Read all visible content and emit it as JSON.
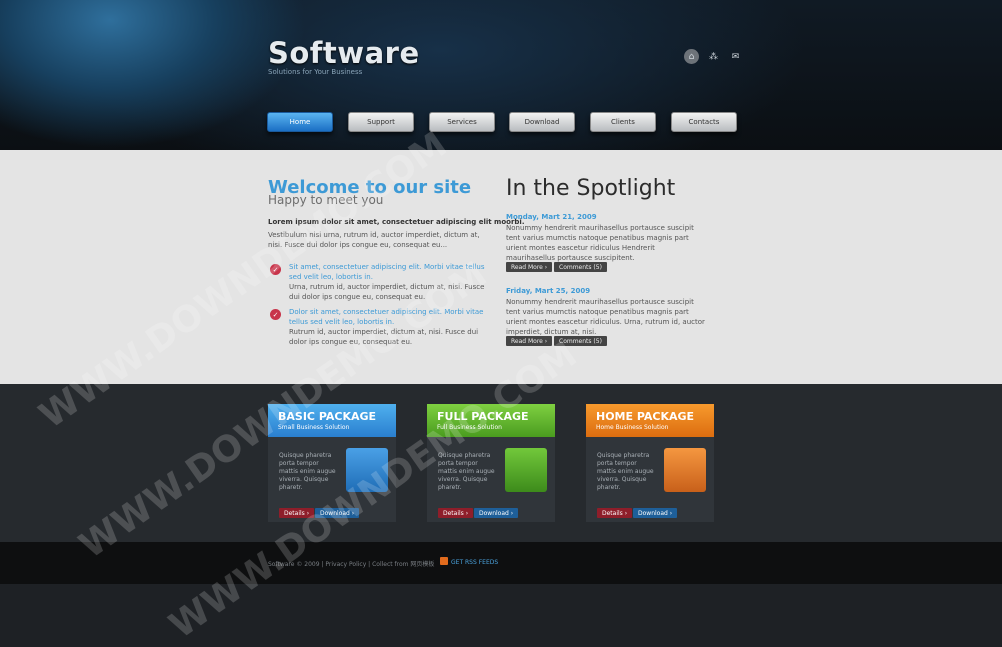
{
  "header": {
    "logo": "Software",
    "tagline": "Solutions for Your Business",
    "icons": [
      "home-icon",
      "sitemap-icon",
      "mail-icon"
    ]
  },
  "nav": {
    "items": [
      "Home",
      "Support",
      "Services",
      "Download",
      "Clients",
      "Contacts"
    ]
  },
  "welcome": {
    "title": "Welcome to our site",
    "subtitle": "Happy to meet you",
    "lead": "Lorem ipsum dolor sit amet, consectetuer adipiscing elit moorbi.",
    "para": "Vestibulum nisi urna, rutrum id, auctor imperdiet, dictum at, nisi. Fusce dui dolor ips congue eu, consequat eu...",
    "items": [
      {
        "highlight": "Sit amet, consectetuer adipiscing elit. Morbi vitae tellus sed velit leo, lobortis in.",
        "text": "Urna, rutrum id, auctor imperdiet, dictum at, nisi. Fusce dui dolor ips congue eu, consequat eu."
      },
      {
        "highlight": "Dolor sit amet, consectetuer adipiscing elit. Morbi vitae tellus sed velit leo, lobortis in.",
        "text": "Rutrum id, auctor imperdiet, dictum at, nisi. Fusce dui dolor ips congue eu, consequat eu."
      }
    ]
  },
  "spotlight": {
    "title": "In the Spotlight",
    "posts": [
      {
        "date": "Monday, Mart 21, 2009",
        "text": "Nonummy hendrerit maurihasellus portausce suscipit tent varius mumctis natoque penatibus magnis part urient montes eascetur ridiculus Hendrerit maurihasellus portausce suscipitent.",
        "read_more": "Read More ›",
        "comments": "Comments (5)"
      },
      {
        "date": "Friday, Mart 25, 2009",
        "text": "Nonummy hendrerit maurihasellus portausce suscipit tent varius mumctis natoque penatibus magnis part urient montes eascetur ridiculus. Urna, rutrum id, auctor imperdiet, dictum at, nisi.",
        "read_more": "Read More ›",
        "comments": "Comments (5)"
      }
    ]
  },
  "packages": [
    {
      "title": "BASIC PACKAGE",
      "sub": "Small Business Solution",
      "desc": "Quisque pharetra porta tempor mattis enim augue viverra. Quisque pharetr.",
      "details": "Details ›",
      "download": "Download ›",
      "color": "#2f8fd6",
      "box_color": "#2d7fc9"
    },
    {
      "title": "FULL PACKAGE",
      "sub": "Full Business Solution",
      "desc": "Quisque pharetra porta tempor mattis enim augue viverra. Quisque pharetr.",
      "details": "Details ›",
      "download": "Download ›",
      "color": "#5fb52a",
      "box_color": "#4fa52a"
    },
    {
      "title": "HOME PACKAGE",
      "sub": "Home Business Solution",
      "desc": "Quisque pharetra porta tempor mattis enim augue viverra. Quisque pharetr.",
      "details": "Details ›",
      "download": "Download ›",
      "color": "#ef7e16",
      "box_color": "#e0751c"
    }
  ],
  "footer": {
    "text": "Software © 2009 | Privacy Policy | Collect from 网页模板",
    "rss": "GET RSS FEEDS"
  },
  "watermark": "WWW.DOWNDEMO.COM"
}
